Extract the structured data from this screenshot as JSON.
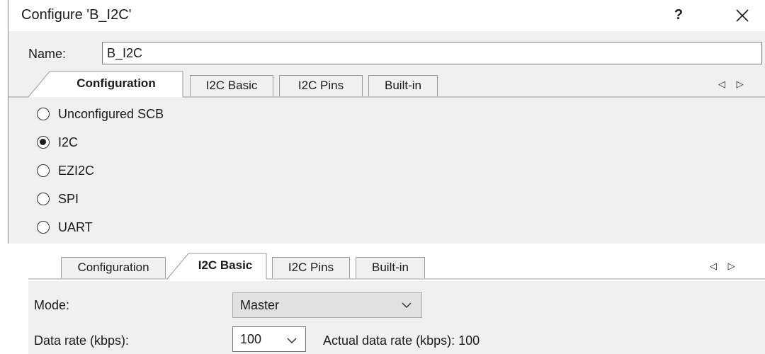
{
  "dialog": {
    "title": "Configure 'B_I2C'",
    "help_label": "?",
    "name_label": "Name:",
    "name_value": "B_I2C"
  },
  "top_tabs": [
    {
      "label": "Configuration",
      "active": true
    },
    {
      "label": "I2C Basic",
      "active": false
    },
    {
      "label": "I2C Pins",
      "active": false
    },
    {
      "label": "Built-in",
      "active": false
    }
  ],
  "scroll_arrows": "◁ ▷",
  "radio_options": [
    {
      "label": "Unconfigured SCB",
      "checked": false
    },
    {
      "label": "I2C",
      "checked": true
    },
    {
      "label": "EZI2C",
      "checked": false
    },
    {
      "label": "SPI",
      "checked": false
    },
    {
      "label": "UART",
      "checked": false
    }
  ],
  "bottom_tabs": [
    {
      "label": "Configuration",
      "active": false
    },
    {
      "label": "I2C Basic",
      "active": true
    },
    {
      "label": "I2C Pins",
      "active": false
    },
    {
      "label": "Built-in",
      "active": false
    }
  ],
  "i2c_basic": {
    "mode_label": "Mode:",
    "mode_value": "Master",
    "data_rate_label": "Data rate (kbps):",
    "data_rate_value": "100",
    "actual_rate_text": "Actual data rate (kbps): 100"
  }
}
